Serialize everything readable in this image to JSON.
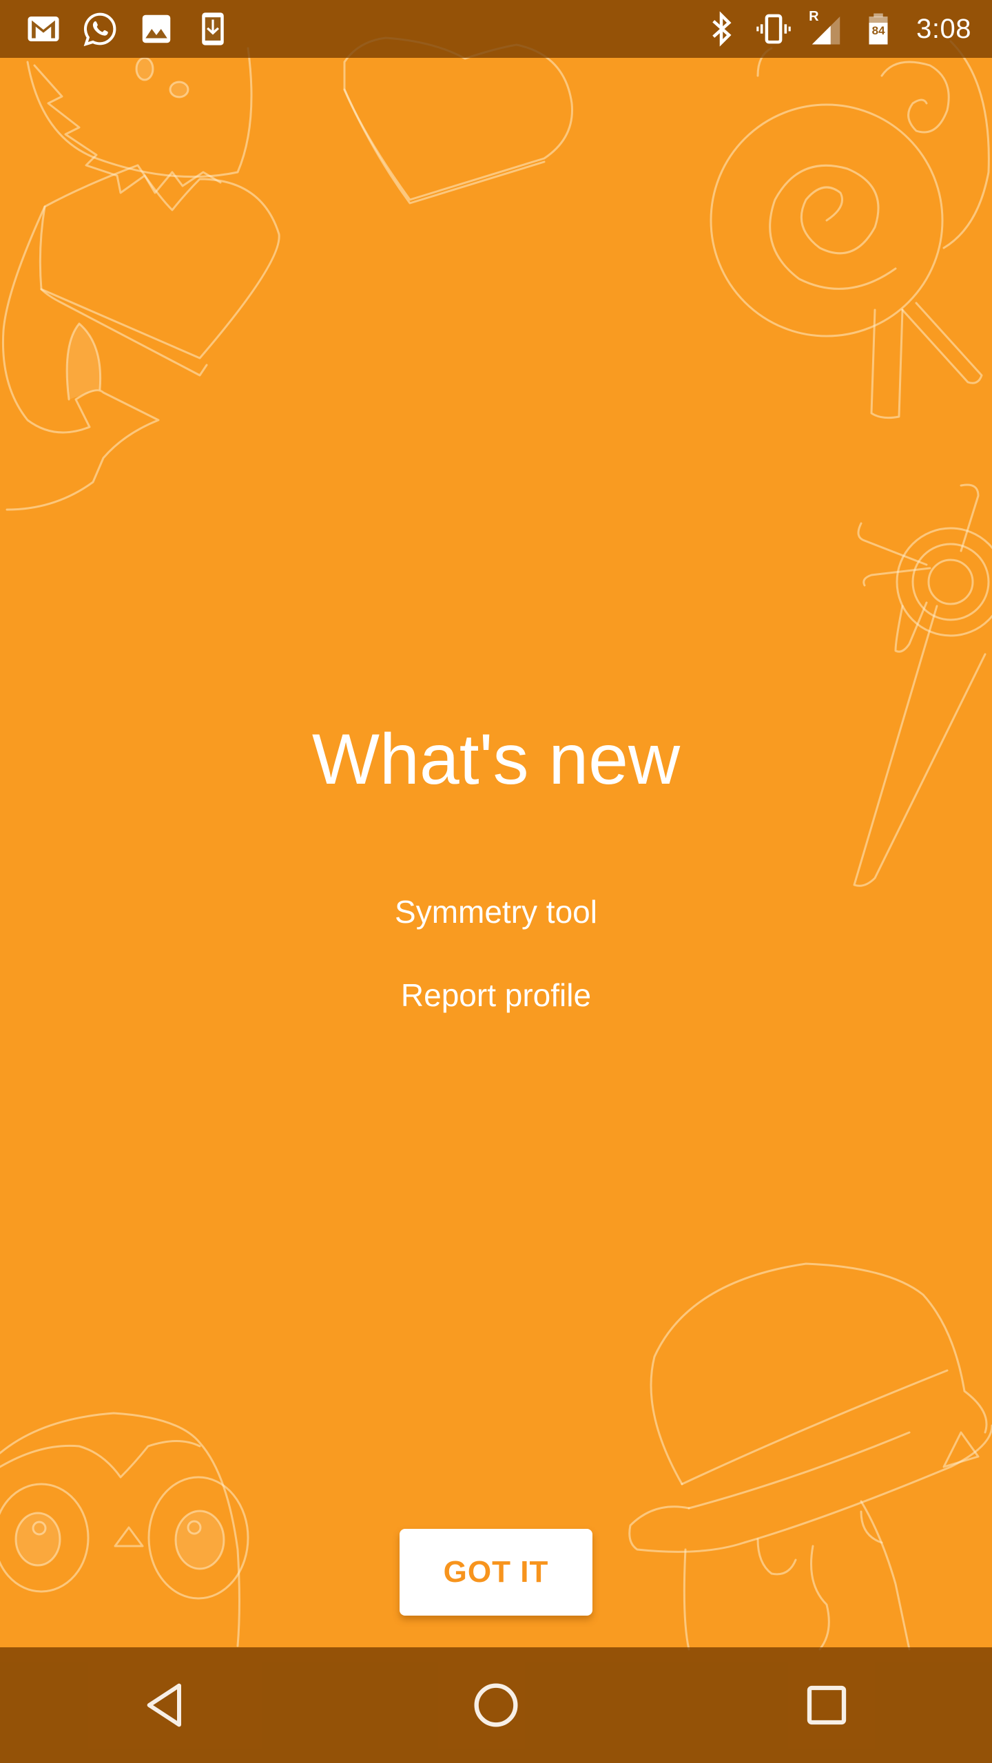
{
  "status_bar": {
    "notification_icons": [
      "gmail-icon",
      "whatsapp-icon",
      "gallery-image-icon",
      "download-icon"
    ],
    "system_icons": [
      "bluetooth-icon",
      "vibrate-icon",
      "signal-roaming-icon",
      "battery-icon"
    ],
    "roaming_indicator": "R",
    "battery_level": "84",
    "time": "3:08"
  },
  "whats_new": {
    "title": "What's new",
    "features": [
      {
        "label": "Symmetry tool"
      },
      {
        "label": "Report profile"
      }
    ],
    "confirm_button": "GOT IT"
  },
  "nav_bar": {
    "buttons": [
      "back",
      "home",
      "recents"
    ]
  },
  "colors": {
    "background": "#F99B21",
    "bars": "#965B14",
    "text": "#FFFFFF",
    "button_text": "#F7941D"
  }
}
